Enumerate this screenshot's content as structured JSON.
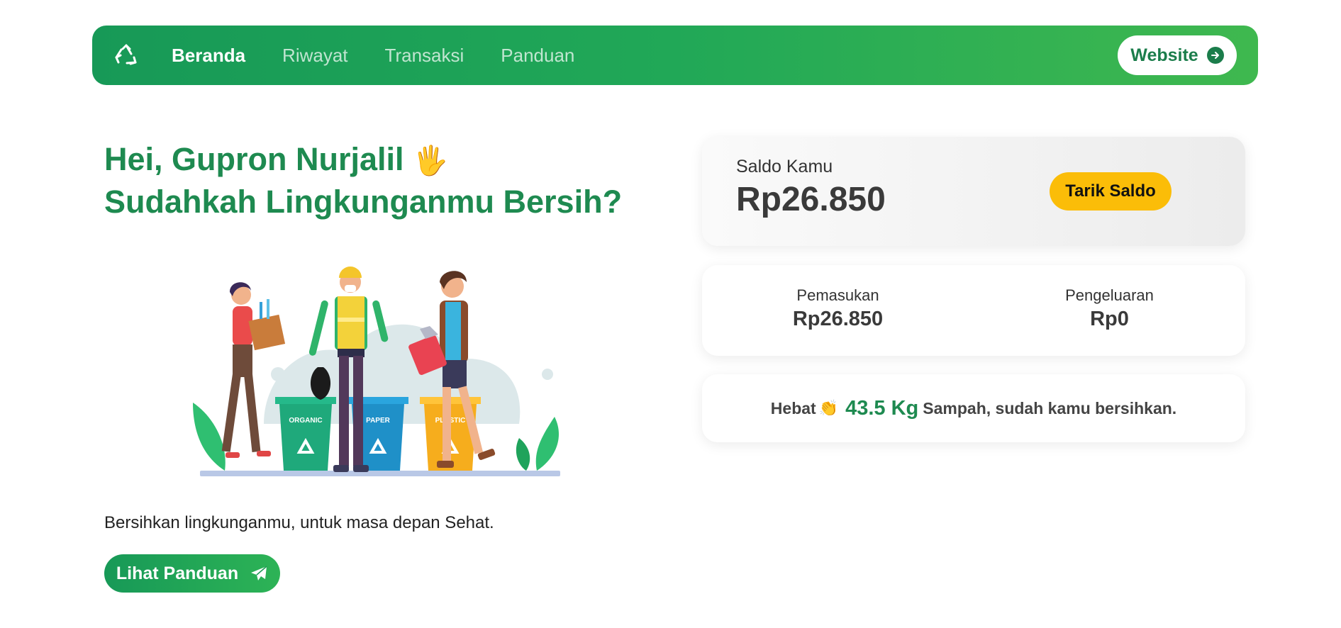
{
  "nav": {
    "logo_icon": "recycle-icon",
    "links": [
      "Beranda",
      "Riwayat",
      "Transaksi",
      "Panduan"
    ],
    "website_label": "Website"
  },
  "hero": {
    "greeting": "Hei, Gupron Nurjalil",
    "wave_emoji": "🖐",
    "question": "Sudahkah Lingkunganmu Bersih?",
    "tagline": "Bersihkan lingkunganmu, untuk masa depan Sehat.",
    "guide_label": "Lihat Panduan",
    "bins": [
      "ORGANIC",
      "PAPER",
      "PLASTIC"
    ]
  },
  "balance": {
    "label": "Saldo Kamu",
    "amount": "Rp26.850",
    "withdraw_label": "Tarik Saldo"
  },
  "flow": {
    "income_label": "Pemasukan",
    "income_value": "Rp26.850",
    "expense_label": "Pengeluaran",
    "expense_value": "Rp0"
  },
  "summary": {
    "prefix": "Hebat",
    "clap_emoji": "👏",
    "weight": "43.5 Kg",
    "suffix": "Sampah, sudah kamu bersihkan."
  },
  "colors": {
    "primary": "#1e8a50",
    "accent_yellow": "#fbbd08"
  }
}
